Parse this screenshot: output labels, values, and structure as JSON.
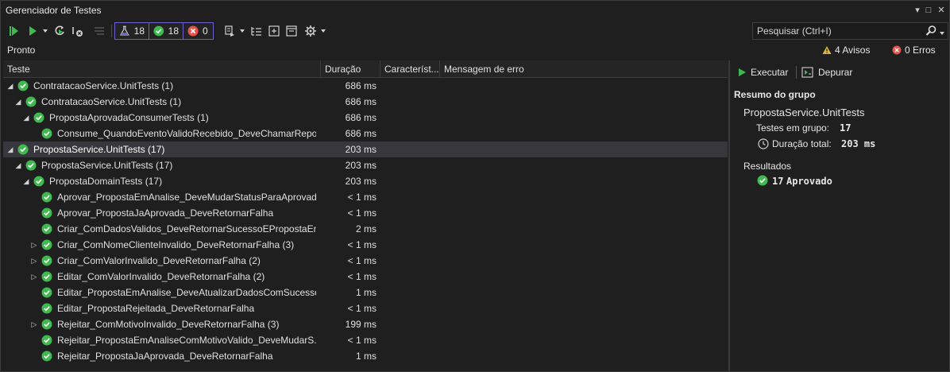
{
  "window": {
    "title": "Gerenciador de Testes"
  },
  "title_controls": [
    "▾",
    "□",
    "✕"
  ],
  "toolbar": {
    "counters": {
      "total": "18",
      "passed": "18",
      "failed": "0"
    }
  },
  "search": {
    "placeholder": "Pesquisar (Ctrl+I)"
  },
  "status": {
    "text": "Pronto",
    "warnings": "4 Avisos",
    "errors": "0 Erros"
  },
  "columns": [
    "Teste",
    "Duração",
    "Característ...",
    "Mensagem de erro"
  ],
  "rows": [
    {
      "name": "ContratacaoService.UnitTests  (1)",
      "duration": "686 ms",
      "level": 0,
      "expander": "expanded"
    },
    {
      "name": "ContratacaoService.UnitTests  (1)",
      "duration": "686 ms",
      "level": 1,
      "expander": "expanded"
    },
    {
      "name": "PropostaAprovadaConsumerTests  (1)",
      "duration": "686 ms",
      "level": 2,
      "expander": "expanded"
    },
    {
      "name": "Consume_QuandoEventoValidoRecebido_DeveChamarRepo...",
      "duration": "686 ms",
      "level": 3,
      "expander": "none"
    },
    {
      "name": "PropostaService.UnitTests  (17)",
      "duration": "203 ms",
      "level": 0,
      "expander": "expanded",
      "selected": true
    },
    {
      "name": "PropostaService.UnitTests  (17)",
      "duration": "203 ms",
      "level": 1,
      "expander": "expanded"
    },
    {
      "name": "PropostaDomainTests  (17)",
      "duration": "203 ms",
      "level": 2,
      "expander": "expanded"
    },
    {
      "name": "Aprovar_PropostaEmAnalise_DeveMudarStatusParaAprovada",
      "duration": "< 1 ms",
      "level": 3,
      "expander": "none"
    },
    {
      "name": "Aprovar_PropostaJaAprovada_DeveRetornarFalha",
      "duration": "< 1 ms",
      "level": 3,
      "expander": "none"
    },
    {
      "name": "Criar_ComDadosValidos_DeveRetornarSucessoEPropostaEm...",
      "duration": "2 ms",
      "level": 3,
      "expander": "none"
    },
    {
      "name": "Criar_ComNomeClienteInvalido_DeveRetornarFalha  (3)",
      "duration": "< 1 ms",
      "level": 3,
      "expander": "collapsed"
    },
    {
      "name": "Criar_ComValorInvalido_DeveRetornarFalha  (2)",
      "duration": "< 1 ms",
      "level": 3,
      "expander": "collapsed"
    },
    {
      "name": "Editar_ComValorInvalido_DeveRetornarFalha  (2)",
      "duration": "< 1 ms",
      "level": 3,
      "expander": "collapsed"
    },
    {
      "name": "Editar_PropostaEmAnalise_DeveAtualizarDadosComSucesso",
      "duration": "1 ms",
      "level": 3,
      "expander": "none"
    },
    {
      "name": "Editar_PropostaRejeitada_DeveRetornarFalha",
      "duration": "< 1 ms",
      "level": 3,
      "expander": "none"
    },
    {
      "name": "Rejeitar_ComMotivoInvalido_DeveRetornarFalha  (3)",
      "duration": "199 ms",
      "level": 3,
      "expander": "collapsed"
    },
    {
      "name": "Rejeitar_PropostaEmAnaliseComMotivoValido_DeveMudarS...",
      "duration": "< 1 ms",
      "level": 3,
      "expander": "none"
    },
    {
      "name": "Rejeitar_PropostaJaAprovada_DeveRetornarFalha",
      "duration": "1 ms",
      "level": 3,
      "expander": "none"
    }
  ],
  "details": {
    "run_label": "Executar",
    "debug_label": "Depurar",
    "summary_heading": "Resumo do grupo",
    "group_name": "PropostaService.UnitTests",
    "tests_in_group_label": "Testes em grupo:",
    "tests_in_group_value": "17",
    "total_duration_label": "Duração total:",
    "total_duration_value": "203 ms",
    "results_heading": "Resultados",
    "passed_count": "17",
    "passed_label": "Aprovado"
  },
  "colors": {
    "pass": "#3fb950",
    "fail": "#e5534b",
    "warn": "#e3b341",
    "accent": "#6b5fd0",
    "selected_row": "#37373d"
  }
}
